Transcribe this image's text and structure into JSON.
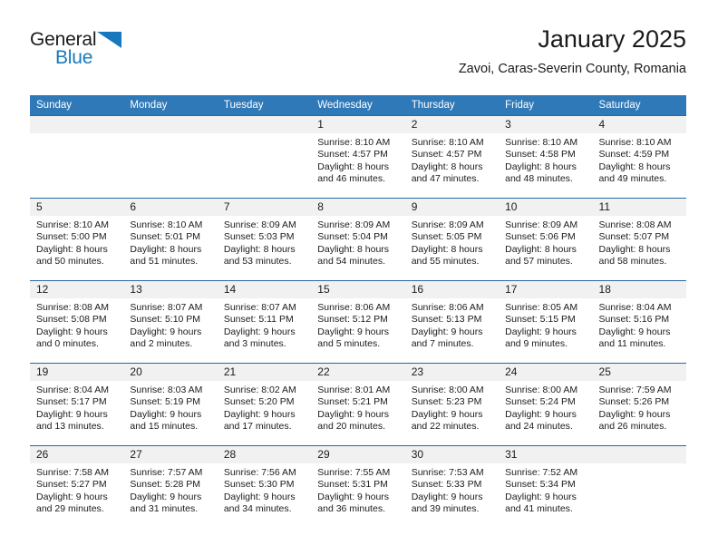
{
  "logo": {
    "word_top": "General",
    "word_bottom": "Blue",
    "accent_color": "#1878be",
    "triangle_icon": "triangle-icon"
  },
  "header": {
    "month_title": "January 2025",
    "location": "Zavoi, Caras-Severin County, Romania"
  },
  "theme": {
    "header_bg": "#3079b8",
    "header_text": "#ffffff",
    "daynum_bg": "#f1f1f1",
    "cell_border": "#2a68a0",
    "text": "#1b1b1b"
  },
  "weekday_headers": [
    "Sunday",
    "Monday",
    "Tuesday",
    "Wednesday",
    "Thursday",
    "Friday",
    "Saturday"
  ],
  "weeks": [
    [
      {
        "day": "",
        "lines": []
      },
      {
        "day": "",
        "lines": []
      },
      {
        "day": "",
        "lines": []
      },
      {
        "day": "1",
        "lines": [
          "Sunrise: 8:10 AM",
          "Sunset: 4:57 PM",
          "Daylight: 8 hours",
          "and 46 minutes."
        ]
      },
      {
        "day": "2",
        "lines": [
          "Sunrise: 8:10 AM",
          "Sunset: 4:57 PM",
          "Daylight: 8 hours",
          "and 47 minutes."
        ]
      },
      {
        "day": "3",
        "lines": [
          "Sunrise: 8:10 AM",
          "Sunset: 4:58 PM",
          "Daylight: 8 hours",
          "and 48 minutes."
        ]
      },
      {
        "day": "4",
        "lines": [
          "Sunrise: 8:10 AM",
          "Sunset: 4:59 PM",
          "Daylight: 8 hours",
          "and 49 minutes."
        ]
      }
    ],
    [
      {
        "day": "5",
        "lines": [
          "Sunrise: 8:10 AM",
          "Sunset: 5:00 PM",
          "Daylight: 8 hours",
          "and 50 minutes."
        ]
      },
      {
        "day": "6",
        "lines": [
          "Sunrise: 8:10 AM",
          "Sunset: 5:01 PM",
          "Daylight: 8 hours",
          "and 51 minutes."
        ]
      },
      {
        "day": "7",
        "lines": [
          "Sunrise: 8:09 AM",
          "Sunset: 5:03 PM",
          "Daylight: 8 hours",
          "and 53 minutes."
        ]
      },
      {
        "day": "8",
        "lines": [
          "Sunrise: 8:09 AM",
          "Sunset: 5:04 PM",
          "Daylight: 8 hours",
          "and 54 minutes."
        ]
      },
      {
        "day": "9",
        "lines": [
          "Sunrise: 8:09 AM",
          "Sunset: 5:05 PM",
          "Daylight: 8 hours",
          "and 55 minutes."
        ]
      },
      {
        "day": "10",
        "lines": [
          "Sunrise: 8:09 AM",
          "Sunset: 5:06 PM",
          "Daylight: 8 hours",
          "and 57 minutes."
        ]
      },
      {
        "day": "11",
        "lines": [
          "Sunrise: 8:08 AM",
          "Sunset: 5:07 PM",
          "Daylight: 8 hours",
          "and 58 minutes."
        ]
      }
    ],
    [
      {
        "day": "12",
        "lines": [
          "Sunrise: 8:08 AM",
          "Sunset: 5:08 PM",
          "Daylight: 9 hours",
          "and 0 minutes."
        ]
      },
      {
        "day": "13",
        "lines": [
          "Sunrise: 8:07 AM",
          "Sunset: 5:10 PM",
          "Daylight: 9 hours",
          "and 2 minutes."
        ]
      },
      {
        "day": "14",
        "lines": [
          "Sunrise: 8:07 AM",
          "Sunset: 5:11 PM",
          "Daylight: 9 hours",
          "and 3 minutes."
        ]
      },
      {
        "day": "15",
        "lines": [
          "Sunrise: 8:06 AM",
          "Sunset: 5:12 PM",
          "Daylight: 9 hours",
          "and 5 minutes."
        ]
      },
      {
        "day": "16",
        "lines": [
          "Sunrise: 8:06 AM",
          "Sunset: 5:13 PM",
          "Daylight: 9 hours",
          "and 7 minutes."
        ]
      },
      {
        "day": "17",
        "lines": [
          "Sunrise: 8:05 AM",
          "Sunset: 5:15 PM",
          "Daylight: 9 hours",
          "and 9 minutes."
        ]
      },
      {
        "day": "18",
        "lines": [
          "Sunrise: 8:04 AM",
          "Sunset: 5:16 PM",
          "Daylight: 9 hours",
          "and 11 minutes."
        ]
      }
    ],
    [
      {
        "day": "19",
        "lines": [
          "Sunrise: 8:04 AM",
          "Sunset: 5:17 PM",
          "Daylight: 9 hours",
          "and 13 minutes."
        ]
      },
      {
        "day": "20",
        "lines": [
          "Sunrise: 8:03 AM",
          "Sunset: 5:19 PM",
          "Daylight: 9 hours",
          "and 15 minutes."
        ]
      },
      {
        "day": "21",
        "lines": [
          "Sunrise: 8:02 AM",
          "Sunset: 5:20 PM",
          "Daylight: 9 hours",
          "and 17 minutes."
        ]
      },
      {
        "day": "22",
        "lines": [
          "Sunrise: 8:01 AM",
          "Sunset: 5:21 PM",
          "Daylight: 9 hours",
          "and 20 minutes."
        ]
      },
      {
        "day": "23",
        "lines": [
          "Sunrise: 8:00 AM",
          "Sunset: 5:23 PM",
          "Daylight: 9 hours",
          "and 22 minutes."
        ]
      },
      {
        "day": "24",
        "lines": [
          "Sunrise: 8:00 AM",
          "Sunset: 5:24 PM",
          "Daylight: 9 hours",
          "and 24 minutes."
        ]
      },
      {
        "day": "25",
        "lines": [
          "Sunrise: 7:59 AM",
          "Sunset: 5:26 PM",
          "Daylight: 9 hours",
          "and 26 minutes."
        ]
      }
    ],
    [
      {
        "day": "26",
        "lines": [
          "Sunrise: 7:58 AM",
          "Sunset: 5:27 PM",
          "Daylight: 9 hours",
          "and 29 minutes."
        ]
      },
      {
        "day": "27",
        "lines": [
          "Sunrise: 7:57 AM",
          "Sunset: 5:28 PM",
          "Daylight: 9 hours",
          "and 31 minutes."
        ]
      },
      {
        "day": "28",
        "lines": [
          "Sunrise: 7:56 AM",
          "Sunset: 5:30 PM",
          "Daylight: 9 hours",
          "and 34 minutes."
        ]
      },
      {
        "day": "29",
        "lines": [
          "Sunrise: 7:55 AM",
          "Sunset: 5:31 PM",
          "Daylight: 9 hours",
          "and 36 minutes."
        ]
      },
      {
        "day": "30",
        "lines": [
          "Sunrise: 7:53 AM",
          "Sunset: 5:33 PM",
          "Daylight: 9 hours",
          "and 39 minutes."
        ]
      },
      {
        "day": "31",
        "lines": [
          "Sunrise: 7:52 AM",
          "Sunset: 5:34 PM",
          "Daylight: 9 hours",
          "and 41 minutes."
        ]
      },
      {
        "day": "",
        "lines": []
      }
    ]
  ]
}
